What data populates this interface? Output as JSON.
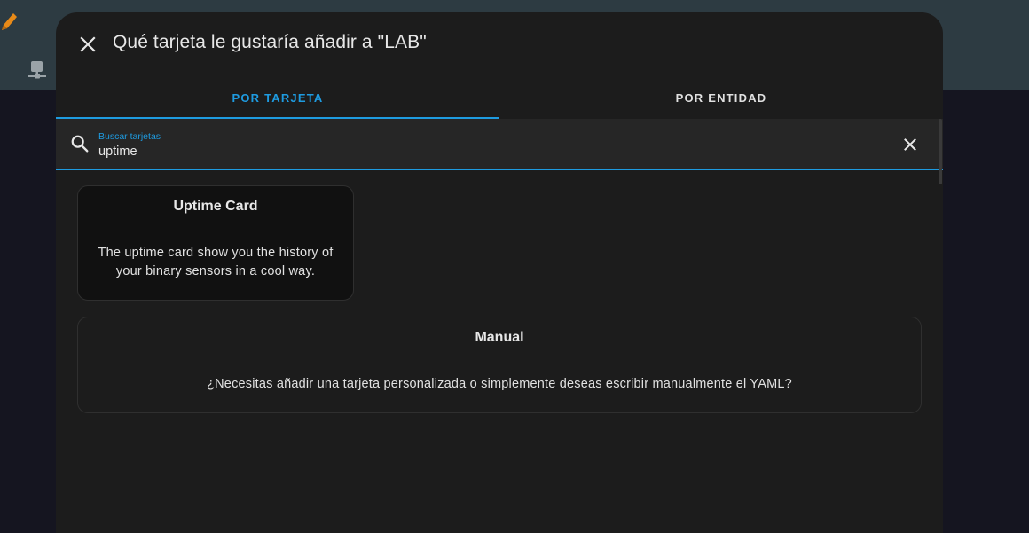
{
  "colors": {
    "accent": "#1e9be0",
    "dialog_bg": "#1c1c1c",
    "pencil": "#e88a18"
  },
  "background": {
    "edit_icon": "pencil-icon",
    "side_icon": "plug-icon"
  },
  "dialog": {
    "title": "Qué tarjeta le gustaría añadir a \"LAB\"",
    "close_icon": "close-icon"
  },
  "tabs": [
    {
      "label": "POR TARJETA",
      "active": true
    },
    {
      "label": "POR ENTIDAD",
      "active": false
    }
  ],
  "search": {
    "label": "Buscar tarjetas",
    "value": "uptime",
    "icon": "search-icon",
    "clear_icon": "clear-icon"
  },
  "cards": [
    {
      "title": "Uptime Card",
      "description": "The uptime card show you the history of your binary sensors in a cool way."
    },
    {
      "title": "Manual",
      "description": "¿Necesitas añadir una tarjeta personalizada o simplemente deseas escribir manualmente el YAML?"
    }
  ]
}
